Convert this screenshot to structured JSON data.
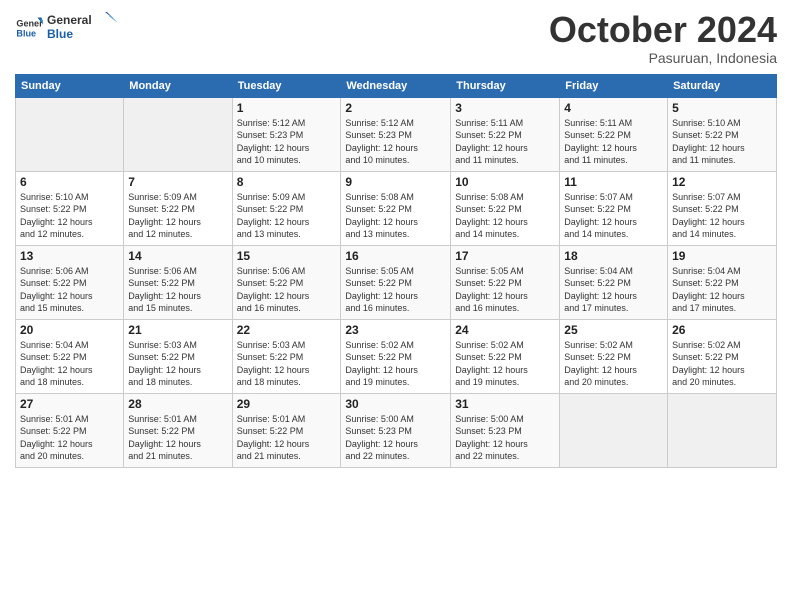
{
  "logo": {
    "line1": "General",
    "line2": "Blue"
  },
  "title": "October 2024",
  "subtitle": "Pasuruan, Indonesia",
  "header_days": [
    "Sunday",
    "Monday",
    "Tuesday",
    "Wednesday",
    "Thursday",
    "Friday",
    "Saturday"
  ],
  "weeks": [
    [
      {
        "day": "",
        "info": ""
      },
      {
        "day": "",
        "info": ""
      },
      {
        "day": "1",
        "info": "Sunrise: 5:12 AM\nSunset: 5:23 PM\nDaylight: 12 hours\nand 10 minutes."
      },
      {
        "day": "2",
        "info": "Sunrise: 5:12 AM\nSunset: 5:23 PM\nDaylight: 12 hours\nand 10 minutes."
      },
      {
        "day": "3",
        "info": "Sunrise: 5:11 AM\nSunset: 5:22 PM\nDaylight: 12 hours\nand 11 minutes."
      },
      {
        "day": "4",
        "info": "Sunrise: 5:11 AM\nSunset: 5:22 PM\nDaylight: 12 hours\nand 11 minutes."
      },
      {
        "day": "5",
        "info": "Sunrise: 5:10 AM\nSunset: 5:22 PM\nDaylight: 12 hours\nand 11 minutes."
      }
    ],
    [
      {
        "day": "6",
        "info": "Sunrise: 5:10 AM\nSunset: 5:22 PM\nDaylight: 12 hours\nand 12 minutes."
      },
      {
        "day": "7",
        "info": "Sunrise: 5:09 AM\nSunset: 5:22 PM\nDaylight: 12 hours\nand 12 minutes."
      },
      {
        "day": "8",
        "info": "Sunrise: 5:09 AM\nSunset: 5:22 PM\nDaylight: 12 hours\nand 13 minutes."
      },
      {
        "day": "9",
        "info": "Sunrise: 5:08 AM\nSunset: 5:22 PM\nDaylight: 12 hours\nand 13 minutes."
      },
      {
        "day": "10",
        "info": "Sunrise: 5:08 AM\nSunset: 5:22 PM\nDaylight: 12 hours\nand 14 minutes."
      },
      {
        "day": "11",
        "info": "Sunrise: 5:07 AM\nSunset: 5:22 PM\nDaylight: 12 hours\nand 14 minutes."
      },
      {
        "day": "12",
        "info": "Sunrise: 5:07 AM\nSunset: 5:22 PM\nDaylight: 12 hours\nand 14 minutes."
      }
    ],
    [
      {
        "day": "13",
        "info": "Sunrise: 5:06 AM\nSunset: 5:22 PM\nDaylight: 12 hours\nand 15 minutes."
      },
      {
        "day": "14",
        "info": "Sunrise: 5:06 AM\nSunset: 5:22 PM\nDaylight: 12 hours\nand 15 minutes."
      },
      {
        "day": "15",
        "info": "Sunrise: 5:06 AM\nSunset: 5:22 PM\nDaylight: 12 hours\nand 16 minutes."
      },
      {
        "day": "16",
        "info": "Sunrise: 5:05 AM\nSunset: 5:22 PM\nDaylight: 12 hours\nand 16 minutes."
      },
      {
        "day": "17",
        "info": "Sunrise: 5:05 AM\nSunset: 5:22 PM\nDaylight: 12 hours\nand 16 minutes."
      },
      {
        "day": "18",
        "info": "Sunrise: 5:04 AM\nSunset: 5:22 PM\nDaylight: 12 hours\nand 17 minutes."
      },
      {
        "day": "19",
        "info": "Sunrise: 5:04 AM\nSunset: 5:22 PM\nDaylight: 12 hours\nand 17 minutes."
      }
    ],
    [
      {
        "day": "20",
        "info": "Sunrise: 5:04 AM\nSunset: 5:22 PM\nDaylight: 12 hours\nand 18 minutes."
      },
      {
        "day": "21",
        "info": "Sunrise: 5:03 AM\nSunset: 5:22 PM\nDaylight: 12 hours\nand 18 minutes."
      },
      {
        "day": "22",
        "info": "Sunrise: 5:03 AM\nSunset: 5:22 PM\nDaylight: 12 hours\nand 18 minutes."
      },
      {
        "day": "23",
        "info": "Sunrise: 5:02 AM\nSunset: 5:22 PM\nDaylight: 12 hours\nand 19 minutes."
      },
      {
        "day": "24",
        "info": "Sunrise: 5:02 AM\nSunset: 5:22 PM\nDaylight: 12 hours\nand 19 minutes."
      },
      {
        "day": "25",
        "info": "Sunrise: 5:02 AM\nSunset: 5:22 PM\nDaylight: 12 hours\nand 20 minutes."
      },
      {
        "day": "26",
        "info": "Sunrise: 5:02 AM\nSunset: 5:22 PM\nDaylight: 12 hours\nand 20 minutes."
      }
    ],
    [
      {
        "day": "27",
        "info": "Sunrise: 5:01 AM\nSunset: 5:22 PM\nDaylight: 12 hours\nand 20 minutes."
      },
      {
        "day": "28",
        "info": "Sunrise: 5:01 AM\nSunset: 5:22 PM\nDaylight: 12 hours\nand 21 minutes."
      },
      {
        "day": "29",
        "info": "Sunrise: 5:01 AM\nSunset: 5:22 PM\nDaylight: 12 hours\nand 21 minutes."
      },
      {
        "day": "30",
        "info": "Sunrise: 5:00 AM\nSunset: 5:23 PM\nDaylight: 12 hours\nand 22 minutes."
      },
      {
        "day": "31",
        "info": "Sunrise: 5:00 AM\nSunset: 5:23 PM\nDaylight: 12 hours\nand 22 minutes."
      },
      {
        "day": "",
        "info": ""
      },
      {
        "day": "",
        "info": ""
      }
    ]
  ]
}
